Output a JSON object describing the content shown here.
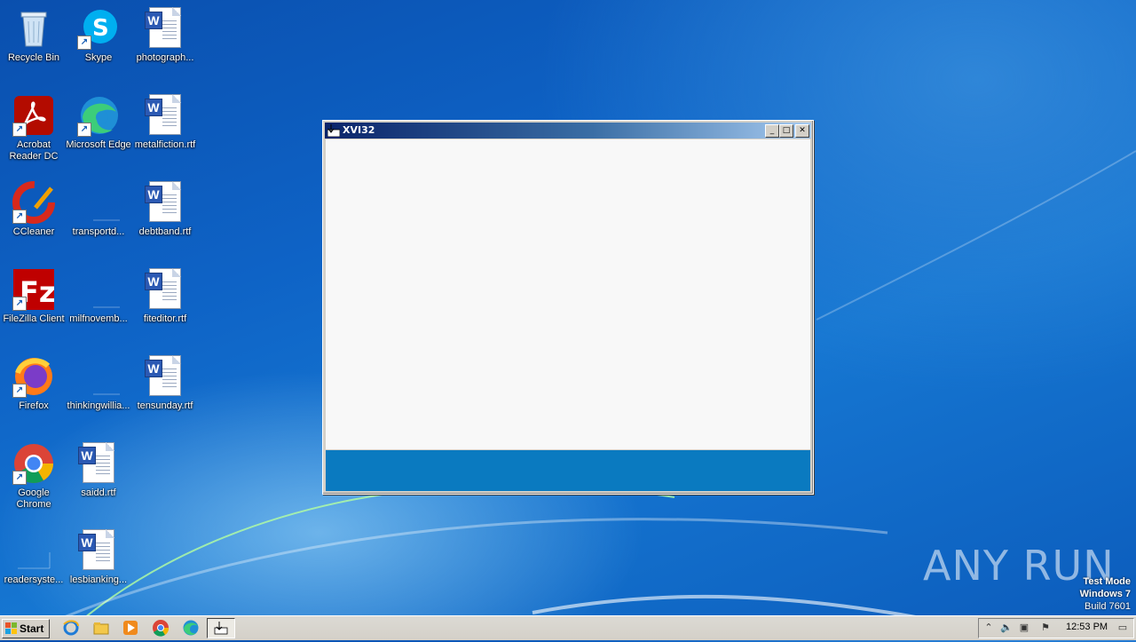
{
  "desktop": {
    "icons": [
      {
        "label": "Recycle Bin"
      },
      {
        "label": "Skype"
      },
      {
        "label": "photograph..."
      },
      {
        "label": "Acrobat Reader DC"
      },
      {
        "label": "Microsoft Edge"
      },
      {
        "label": "metalfiction.rtf"
      },
      {
        "label": "CCleaner"
      },
      {
        "label": "transportd..."
      },
      {
        "label": "debtband.rtf"
      },
      {
        "label": "FileZilla Client"
      },
      {
        "label": "milfnovemb..."
      },
      {
        "label": "fiteditor.rtf"
      },
      {
        "label": "Firefox"
      },
      {
        "label": "thinkingwillia..."
      },
      {
        "label": "tensunday.rtf"
      },
      {
        "label": "Google Chrome"
      },
      {
        "label": "saidd.rtf"
      },
      {
        "label": "readersyste..."
      },
      {
        "label": "lesbianking..."
      }
    ]
  },
  "window": {
    "title": "XVI32",
    "status_color": "#0a7ac0"
  },
  "taskbar": {
    "start_label": "Start",
    "clock": "12:53 PM",
    "pinned": [
      "internet-explorer-icon",
      "file-explorer-icon",
      "media-player-icon",
      "chrome-icon",
      "edge-icon",
      "xvi32-icon"
    ]
  },
  "watermark": {
    "text": "ANY RUN"
  },
  "os_notice": {
    "line1": "Test Mode",
    "line2": "Windows 7",
    "line3": "Build 7601"
  }
}
